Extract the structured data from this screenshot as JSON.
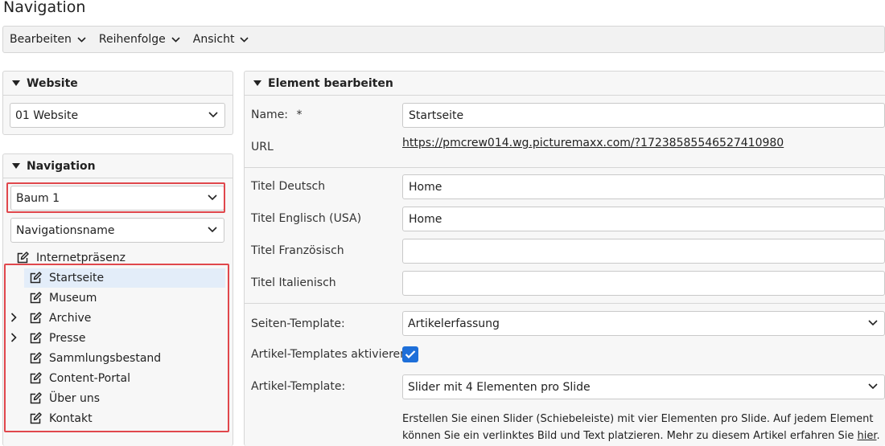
{
  "page": {
    "title": "Navigation"
  },
  "toolbar": {
    "menus": [
      {
        "label": "Bearbeiten",
        "icon": "chevron-down-icon"
      },
      {
        "label": "Reihenfolge",
        "icon": "chevron-down-icon"
      },
      {
        "label": "Ansicht",
        "icon": "chevron-down-icon"
      }
    ]
  },
  "website_panel": {
    "title": "Website",
    "select_value": "01 Website"
  },
  "navigation_panel": {
    "title": "Navigation",
    "tree_select_value": "Baum 1",
    "name_select_value": "Navigationsname",
    "root": {
      "label": "Internetpräsenz",
      "icon": "edit-icon"
    },
    "items": [
      {
        "label": "Startseite",
        "selected": true,
        "expandable": false,
        "icon": "edit-icon"
      },
      {
        "label": "Museum",
        "selected": false,
        "expandable": false,
        "icon": "edit-icon"
      },
      {
        "label": "Archive",
        "selected": false,
        "expandable": true,
        "icon": "edit-icon"
      },
      {
        "label": "Presse",
        "selected": false,
        "expandable": true,
        "icon": "edit-icon"
      },
      {
        "label": "Sammlungsbestand",
        "selected": false,
        "expandable": false,
        "icon": "edit-icon"
      },
      {
        "label": "Content-Portal",
        "selected": false,
        "expandable": false,
        "icon": "edit-icon"
      },
      {
        "label": "Über uns",
        "selected": false,
        "expandable": false,
        "icon": "edit-icon"
      },
      {
        "label": "Kontakt",
        "selected": false,
        "expandable": false,
        "icon": "edit-icon"
      }
    ]
  },
  "edit_panel": {
    "title": "Element bearbeiten",
    "name_label": "Name:",
    "required_marker": "*",
    "name_value": "Startseite",
    "url_label": "URL",
    "url_value": "https://pmcrew014.wg.picturemaxx.com/?17238585546527410980",
    "title_de_label": "Titel Deutsch",
    "title_de_value": "Home",
    "title_en_label": "Titel Englisch (USA)",
    "title_en_value": "Home",
    "title_fr_label": "Titel Französisch",
    "title_fr_value": "",
    "title_it_label": "Titel Italienisch",
    "title_it_value": "",
    "page_template_label": "Seiten-Template:",
    "page_template_value": "Artikelerfassung",
    "article_templates_label": "Artikel-Templates aktivieren:",
    "article_templates_checked": true,
    "article_template_label": "Artikel-Template:",
    "article_template_value": "Slider mit 4 Elementen pro Slide",
    "description_line1": "Erstellen Sie einen Slider (Schiebeleiste) mit vier Elementen pro Slide. Auf jedem Element",
    "description_line2": "können Sie ein verlinktes Bild und Text platzieren. Mehr zu diesem Artikel erfahren Sie ",
    "description_link": "hier",
    "description_end": "."
  },
  "colors": {
    "highlight": "#e0474c",
    "accent": "#1e6fd9",
    "selected_row": "#e3edf9"
  }
}
